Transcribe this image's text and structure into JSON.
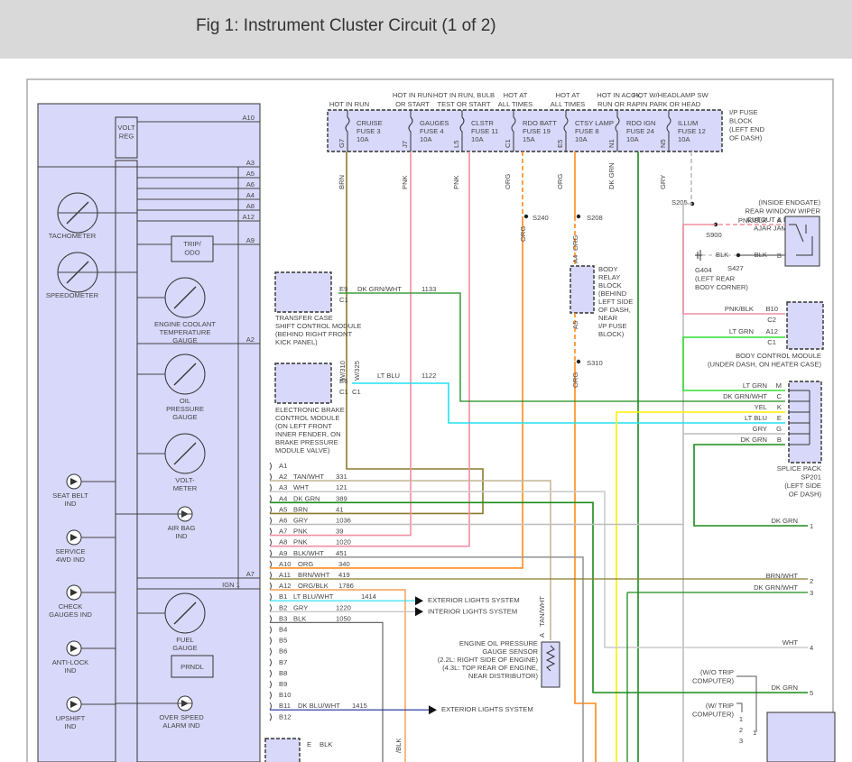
{
  "title": "Fig 1: Instrument Cluster Circuit (1 of 2)",
  "colors": {
    "lavender": "#d8d8fa",
    "brn": "#8b7a2a",
    "pnk": "#f08fa0",
    "org": "#ff8c1a",
    "dkgrn": "#1a8c1a",
    "ltgrn": "#33dd33",
    "gry": "#bdbdbd",
    "yel": "#ffee00",
    "ltblu": "#22e0f0",
    "tan": "#c8b89a",
    "dkblu": "#1a2a9a"
  },
  "fuse_block": {
    "label": [
      "I/P FUSE",
      "BLOCK",
      "(LEFT END",
      "OF DASH)"
    ],
    "fuses": [
      {
        "hot": [
          "",
          "HOT IN RUN"
        ],
        "name": "CRUISE",
        "fuse": "FUSE 3",
        "amps": "10A",
        "pin": "G7",
        "wire": "BRN"
      },
      {
        "hot": [
          "HOT IN RUN",
          "OR START"
        ],
        "name": "GAUGES",
        "fuse": "FUSE 4",
        "amps": "10A",
        "pin": "J7",
        "wire": "PNK"
      },
      {
        "hot": [
          "HOT IN RUN, BULB",
          "TEST OR START"
        ],
        "name": "CLSTR",
        "fuse": "FUSE 11",
        "amps": "10A",
        "pin": "L5",
        "wire": "PNK"
      },
      {
        "hot": [
          "HOT AT",
          "ALL TIMES"
        ],
        "name": "RDO BATT",
        "fuse": "FUSE 19",
        "amps": "15A",
        "pin": "C1",
        "wire": "ORG"
      },
      {
        "hot": [
          "HOT AT",
          "ALL TIMES"
        ],
        "name": "CTSY LAMP",
        "fuse": "FUSE 8",
        "amps": "10A",
        "pin": "E5",
        "wire": "ORG"
      },
      {
        "hot": [
          "HOT IN ACCY,",
          "RUN OR RAP"
        ],
        "name": "RDO IGN",
        "fuse": "FUSE 24",
        "amps": "10A",
        "pin": "N1",
        "wire": "DK GRN"
      },
      {
        "hot": [
          "HOT W/HEADLAMP SW",
          "IN PARK OR HEAD"
        ],
        "name": "ILLUM",
        "fuse": "FUSE 12",
        "amps": "10A",
        "pin": "N5",
        "wire": "GRY"
      }
    ]
  },
  "cluster": {
    "volt_reg": [
      "VOLT",
      "REG"
    ],
    "trip_odo": [
      "TRIP/",
      "ODO"
    ],
    "prndl": "PRNDL",
    "gauges": [
      {
        "label": [
          "TACHOMETER"
        ]
      },
      {
        "label": [
          "SPEEDOMETER"
        ]
      },
      {
        "label": [
          "ENGINE COOLANT",
          "TEMPERATURE",
          "GAUGE"
        ]
      },
      {
        "label": [
          "OIL",
          "PRESSURE",
          "GAUGE"
        ]
      },
      {
        "label": [
          "VOLT-",
          "METER"
        ]
      },
      {
        "label": [
          "FUEL",
          "GAUGE"
        ]
      }
    ],
    "indicators": [
      {
        "label": [
          "SEAT BELT",
          "IND"
        ]
      },
      {
        "label": [
          "SERVICE",
          "4WD IND"
        ]
      },
      {
        "label": [
          "CHECK",
          "GAUGES IND"
        ]
      },
      {
        "label": [
          "ANTI-LOCK",
          "IND"
        ]
      },
      {
        "label": [
          "UPSHIFT",
          "IND"
        ]
      },
      {
        "label": [
          "AIR BAG",
          "IND"
        ]
      },
      {
        "label": [
          "OVER SPEED",
          "ALARM IND"
        ]
      }
    ],
    "pins": [
      "A10",
      "A3",
      "A5",
      "A6",
      "A4",
      "A8",
      "A12",
      "A9",
      "A2",
      "A7",
      "IGN 1"
    ]
  },
  "connector_pins": [
    {
      "pin": "A1",
      "wire": "",
      "circuit": ""
    },
    {
      "pin": "A2",
      "wire": "TAN/WHT",
      "circuit": "331"
    },
    {
      "pin": "A3",
      "wire": "WHT",
      "circuit": "121"
    },
    {
      "pin": "A4",
      "wire": "DK GRN",
      "circuit": "389"
    },
    {
      "pin": "A5",
      "wire": "BRN",
      "circuit": "41"
    },
    {
      "pin": "A6",
      "wire": "GRY",
      "circuit": "1036"
    },
    {
      "pin": "A7",
      "wire": "PNK",
      "circuit": "39"
    },
    {
      "pin": "A8",
      "wire": "PNK",
      "circuit": "1020"
    },
    {
      "pin": "A9",
      "wire": "BLK/WHT",
      "circuit": "451"
    },
    {
      "pin": "A10",
      "wire": "ORG",
      "circuit": "340"
    },
    {
      "pin": "A11",
      "wire": "BRN/WHT",
      "circuit": "419"
    },
    {
      "pin": "A12",
      "wire": "ORG/BLK",
      "circuit": "1786"
    },
    {
      "pin": "B1",
      "wire": "LT BLU/WHT",
      "circuit": "1414"
    },
    {
      "pin": "B2",
      "wire": "GRY",
      "circuit": "1220"
    },
    {
      "pin": "B3",
      "wire": "BLK",
      "circuit": "1050"
    },
    {
      "pin": "B4",
      "wire": "",
      "circuit": ""
    },
    {
      "pin": "B5",
      "wire": "",
      "circuit": ""
    },
    {
      "pin": "B6",
      "wire": "",
      "circuit": ""
    },
    {
      "pin": "B7",
      "wire": "",
      "circuit": ""
    },
    {
      "pin": "B8",
      "wire": "",
      "circuit": ""
    },
    {
      "pin": "B9",
      "wire": "",
      "circuit": ""
    },
    {
      "pin": "B10",
      "wire": "",
      "circuit": ""
    },
    {
      "pin": "B11",
      "wire": "DK BLU/WHT",
      "circuit": "1415"
    },
    {
      "pin": "B12",
      "wire": "",
      "circuit": ""
    }
  ],
  "arrows": {
    "b1": "EXTERIOR LIGHTS SYSTEM",
    "b2": "INTERIOR LIGHTS SYSTEM",
    "b11": "EXTERIOR LIGHTS SYSTEM"
  },
  "transfer_case": {
    "label": [
      "TRANSFER CASE",
      "SHIFT CONTROL MODULE",
      "(BEHIND RIGHT FRONT",
      "KICK PANEL)"
    ],
    "pin": "E9",
    "conn": "C1",
    "wire": "DK GRN/WHT",
    "circuit": "1133"
  },
  "ebcm": {
    "label": [
      "ELECTRONIC BRAKE",
      "CONTROL MODULE",
      "(ON LEFT FRONT",
      "INNER FENDER, ON",
      "BRAKE PRESSURE",
      "MODULE VALVE)"
    ],
    "pin": "B6",
    "conn1": "C1",
    "conn2": "C1",
    "v1": "W/310",
    "v2": "W/325",
    "wire": "LT BLU",
    "circuit": "1122"
  },
  "splices": {
    "s240": "S240",
    "s208": "S208",
    "s310": "S310",
    "s205": "S205",
    "s900": "S900",
    "s427": "S427"
  },
  "body_relay": {
    "label": [
      "BODY",
      "RELAY",
      "BLOCK",
      "(BEHIND",
      "LEFT SIDE",
      "OF DASH,",
      "NEAR",
      "I/P FUSE",
      "BLOCK)"
    ],
    "a4": "A4",
    "a5": "A5"
  },
  "wiper_switch": {
    "label": [
      "(INSIDE ENDGATE)",
      "REAR WINDOW WIPER",
      "CUTOUT & LIFTGLASS",
      "AJAR JAMB SWITCH"
    ],
    "pin_a": "A",
    "pin_b": "B",
    "wire_a": "PNK/BLK",
    "wire_b": "BLK"
  },
  "ground": {
    "label": [
      "G404",
      "(LEFT REAR",
      "BODY CORNER)"
    ],
    "wire": "BLK"
  },
  "bcm": {
    "label": [
      "BODY CONTROL MODULE",
      "(UNDER DASH, ON HEATER CASE)"
    ],
    "p1": "B10",
    "c1": "C2",
    "w1": "PNK/BLK",
    "p2": "A12",
    "c2": "C1",
    "w2": "LT GRN"
  },
  "splice_pack": {
    "label": [
      "SPLICE PACK",
      "SP201",
      "(LEFT SIDE",
      "OF DASH)"
    ],
    "pins": [
      {
        "pin": "M",
        "wire": "LT GRN"
      },
      {
        "pin": "C",
        "wire": "DK GRN/WHT"
      },
      {
        "pin": "K",
        "wire": "YEL"
      },
      {
        "pin": "E",
        "wire": "LT BLU"
      },
      {
        "pin": "G",
        "wire": "GRY"
      },
      {
        "pin": "B",
        "wire": "DK GRN"
      }
    ]
  },
  "right_outputs": [
    {
      "num": "1",
      "wire": "DK GRN"
    },
    {
      "num": "2",
      "wire": "BRN/WHT"
    },
    {
      "num": "3",
      "wire": "DK GRN/WHT"
    },
    {
      "num": "4",
      "wire": "WHT"
    },
    {
      "num": "5",
      "wire": "DK GRN"
    }
  ],
  "sensor": {
    "label": [
      "ENGINE OIL PRESSURE",
      "GAUGE SENSOR",
      "(2.2L: RIGHT SIDE OF ENGINE)",
      "(4.3L: TOP REAR OF ENGINE,",
      "NEAR DISTRIBUTOR)"
    ],
    "pin": "A",
    "wire": "TAN/WHT"
  },
  "trip": {
    "wo": [
      "(W/O TRIP",
      "COMPUTER)"
    ],
    "w": [
      "(W/ TRIP",
      "COMPUTER)"
    ],
    "nums": [
      "1",
      "2",
      "3"
    ],
    "n1": "1"
  },
  "bottom": {
    "e": "E",
    "blk": "BLK",
    "vblk": "/BLK"
  }
}
